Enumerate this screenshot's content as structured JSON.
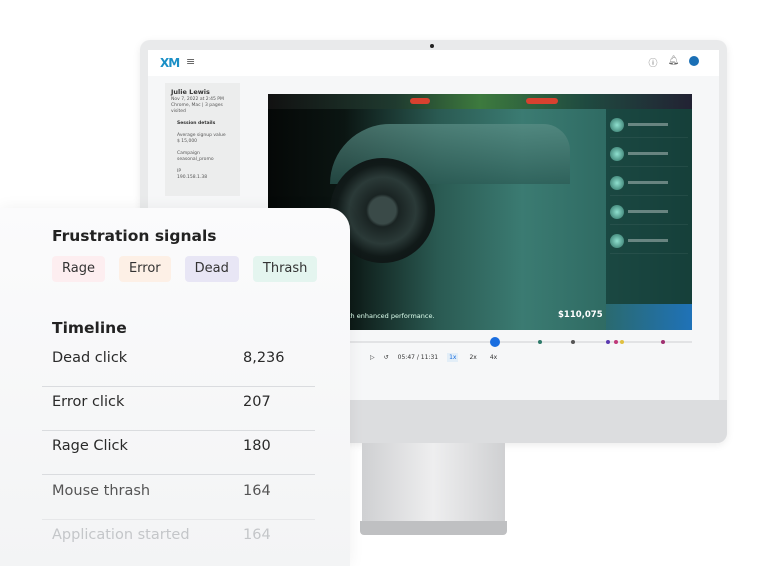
{
  "app": {
    "logo": "XM",
    "menu_icon": "hamburger-icon"
  },
  "session": {
    "user": "Julie Lewis",
    "date": "Nov 7, 2022 at 2:45 PM",
    "browser": "Chrome, Mac | 3 pages visited",
    "details_title": "Session details",
    "fields": [
      {
        "label": "Average signup value",
        "value": "$ 15,000"
      },
      {
        "label": "Campaign",
        "value": "seasonal_promo"
      },
      {
        "label": "IP",
        "value": "190.158.1.38"
      }
    ]
  },
  "video": {
    "tagline": "th enhanced performance.",
    "price": "$110,075"
  },
  "player": {
    "time": "05:47 / 11:31",
    "speeds": [
      "1x",
      "2x",
      "4x"
    ],
    "active_speed": "1x",
    "progress_percent": 50
  },
  "colors": {
    "accent": "#1a6ee0",
    "rage": "#fde9ec",
    "error": "#fdeee3",
    "dead": "#e8e6f5",
    "thrash": "#e2f5ef"
  },
  "panel": {
    "title": "Frustration signals",
    "chips": [
      "Rage",
      "Error",
      "Dead",
      "Thrash"
    ],
    "timeline_title": "Timeline",
    "rows": [
      {
        "label": "Dead click",
        "value": "8,236"
      },
      {
        "label": "Error click",
        "value": "207"
      },
      {
        "label": "Rage Click",
        "value": "180"
      },
      {
        "label": "Mouse thrash",
        "value": "164"
      },
      {
        "label": "Application started",
        "value": "164"
      }
    ]
  }
}
